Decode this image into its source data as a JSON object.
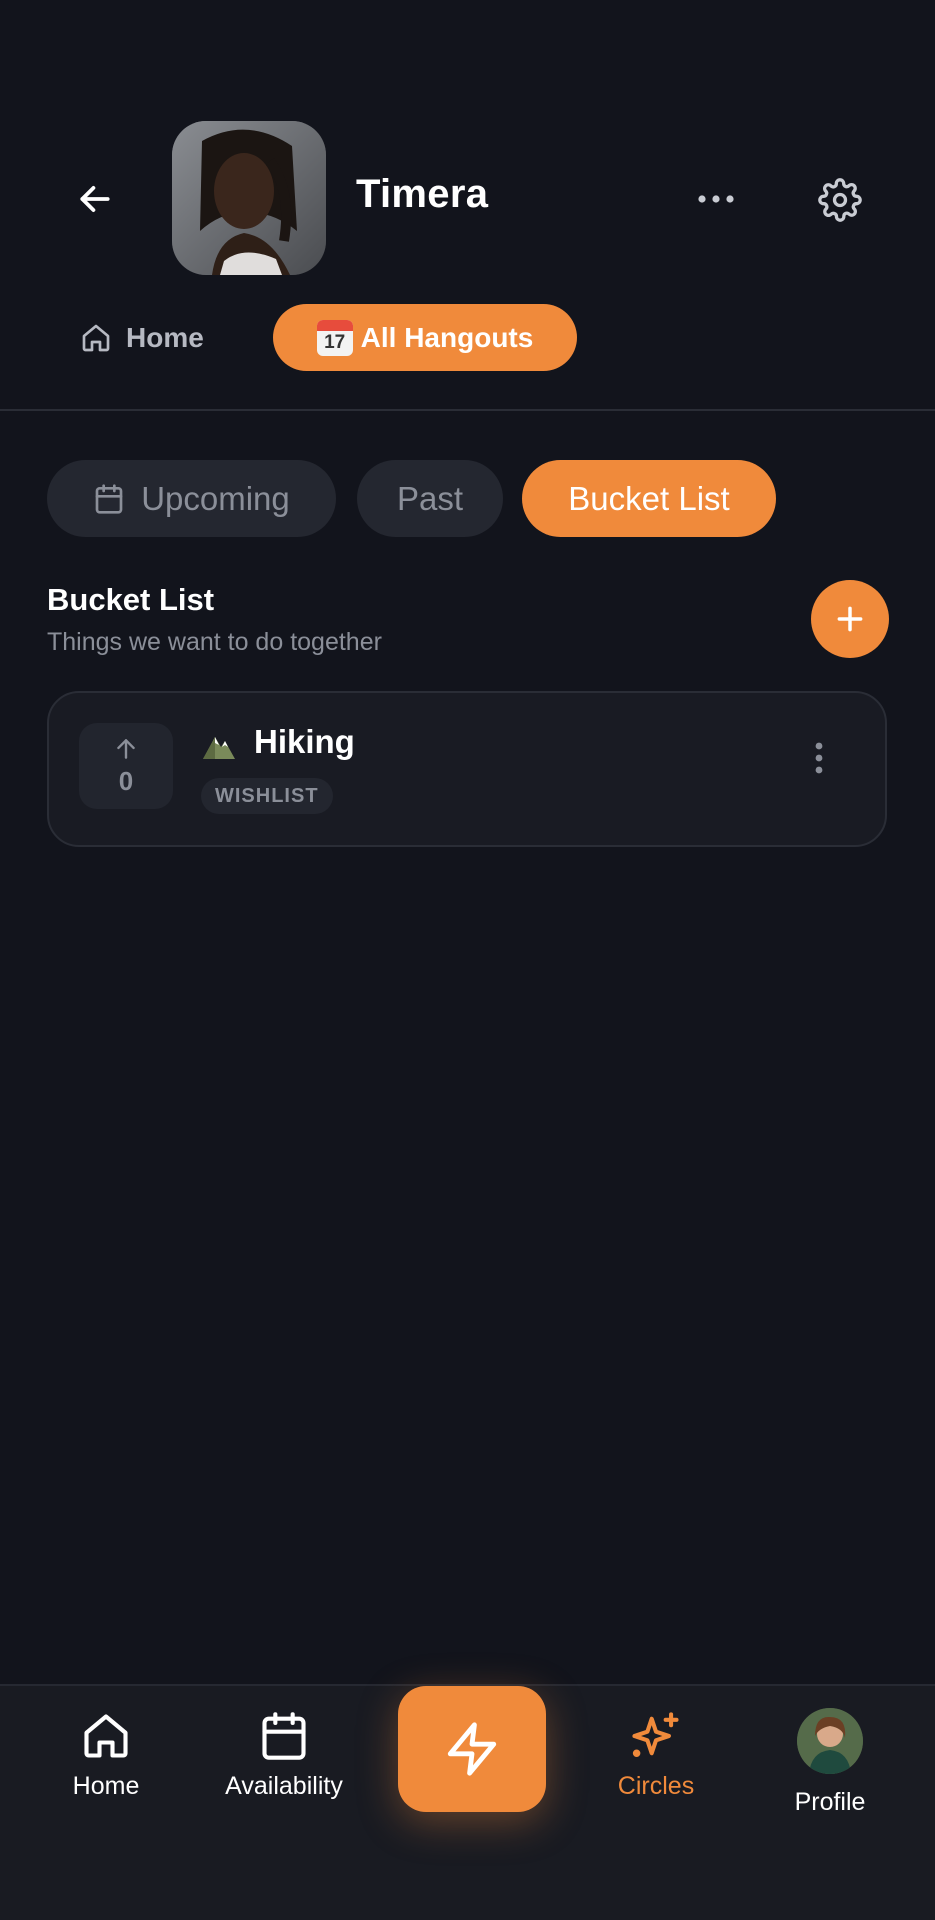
{
  "header": {
    "title": "Timera",
    "back_icon": "arrow-left-icon",
    "more_icon": "more-horizontal-icon",
    "settings_icon": "gear-icon"
  },
  "top_tabs": {
    "home_label": "Home",
    "hangouts_emoji_day": "17",
    "hangouts_label": "All Hangouts"
  },
  "segments": {
    "upcoming": "Upcoming",
    "past": "Past",
    "bucket_list": "Bucket List"
  },
  "section": {
    "title": "Bucket List",
    "subtitle": "Things we want to do together"
  },
  "items": [
    {
      "title": "Hiking",
      "votes": "0",
      "badge": "WISHLIST",
      "emoji_icon": "mountain-icon"
    }
  ],
  "bottom_nav": {
    "home": "Home",
    "availability": "Availability",
    "circles": "Circles",
    "profile": "Profile"
  },
  "colors": {
    "background": "#12141c",
    "accent": "#f08a3b",
    "muted_text": "#8b8f99",
    "card": "#191b23"
  }
}
